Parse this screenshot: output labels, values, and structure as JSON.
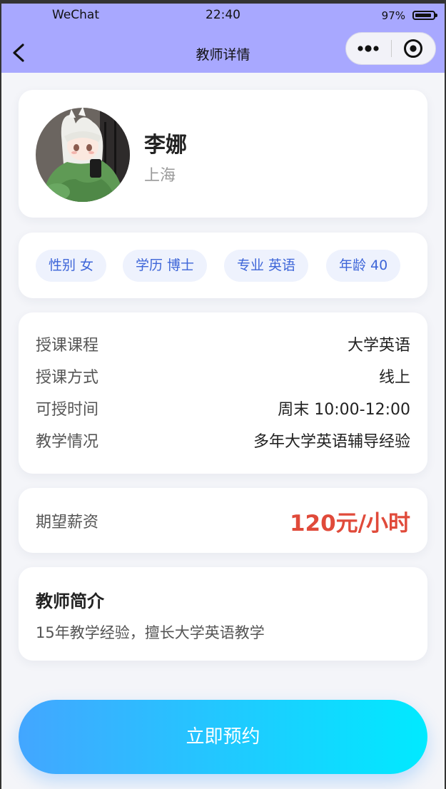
{
  "status_bar": {
    "carrier": "WeChat",
    "time": "22:40",
    "battery": "97%",
    "battery_level": 0.97
  },
  "nav": {
    "title": "教师详情",
    "back_icon": "chevron-left-icon",
    "more_icon": "more-dots-icon",
    "close_icon": "target-circle-icon"
  },
  "profile": {
    "name": "李娜",
    "location": "上海"
  },
  "tags": [
    {
      "text": "性别 女"
    },
    {
      "text": "学历 博士"
    },
    {
      "text": "专业 英语"
    },
    {
      "text": "年龄 40"
    }
  ],
  "info": [
    {
      "label": "授课课程",
      "value": "大学英语"
    },
    {
      "label": "授课方式",
      "value": "线上"
    },
    {
      "label": "可授时间",
      "value": "周末 10:00-12:00"
    },
    {
      "label": "教学情况",
      "value": "多年大学英语辅导经验"
    }
  ],
  "salary": {
    "label": "期望薪资",
    "value": "120元/小时"
  },
  "intro": {
    "title": "教师简介",
    "text": "15年教学经验，擅长大学英语教学"
  },
  "actions": {
    "book_label": "立即预约"
  },
  "colors": {
    "header_bg": "#a8a8ff",
    "tag_bg": "#eef2fd",
    "tag_text": "#3d65d8",
    "salary": "#e04a3a",
    "button_gradient_start": "#43a6ff",
    "button_gradient_end": "#00eaff"
  }
}
